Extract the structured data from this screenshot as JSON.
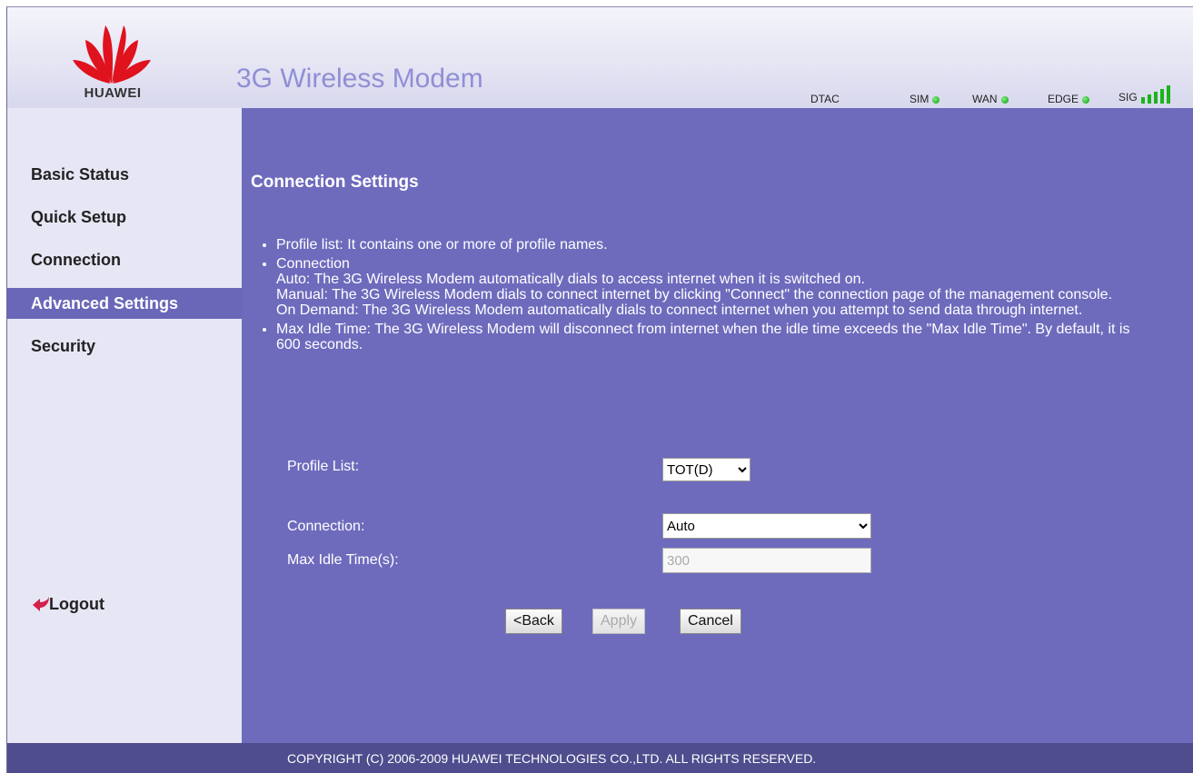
{
  "brand": {
    "logo_text": "HUAWEI",
    "title": "3G Wireless Modem"
  },
  "status": {
    "operator": "DTAC",
    "indicators": [
      {
        "label": "SIM",
        "color": "#1fbf1f"
      },
      {
        "label": "WAN",
        "color": "#1fbf1f"
      },
      {
        "label": "EDGE",
        "color": "#1fbf1f"
      }
    ],
    "signal_label": "SIG",
    "signal_bars": 5
  },
  "sidebar": {
    "items": [
      {
        "label": "Basic Status"
      },
      {
        "label": "Quick Setup"
      },
      {
        "label": "Connection"
      },
      {
        "label": "Advanced Settings",
        "active": true
      },
      {
        "label": "Security"
      }
    ],
    "logout": "Logout"
  },
  "main": {
    "title": "Connection Settings",
    "help": [
      "Profile list: It contains one or more of profile names.",
      "Connection",
      "Auto: The 3G Wireless Modem automatically dials to access internet when it is switched on.",
      "Manual: The 3G Wireless Modem dials to connect internet by clicking \"Connect\" the connection page of the management console.",
      "On Demand: The 3G Wireless Modem automatically dials to connect internet when you attempt to send data through internet.",
      "Max Idle Time: The 3G Wireless Modem will disconnect from internet when the idle time exceeds the \"Max Idle Time\". By default, it is 600 seconds."
    ],
    "form": {
      "profile_label": "Profile List:",
      "profile_value": "TOT(D)",
      "connection_label": "Connection:",
      "connection_value": "Auto",
      "idle_label": "Max Idle Time(s):",
      "idle_value": "300"
    },
    "buttons": {
      "back": "<Back",
      "apply": "Apply",
      "cancel": "Cancel"
    }
  },
  "footer": {
    "copyright": "COPYRIGHT (C) 2006-2009 HUAWEI TECHNOLOGIES CO.,LTD. ALL RIGHTS RESERVED."
  },
  "colors": {
    "main_bg": "#6e6bbd",
    "sidebar_bg": "#e6e6f5",
    "active_nav": "#6a67b9",
    "footer_bg": "#4f4d8e",
    "title_text": "#8f8fd6"
  }
}
